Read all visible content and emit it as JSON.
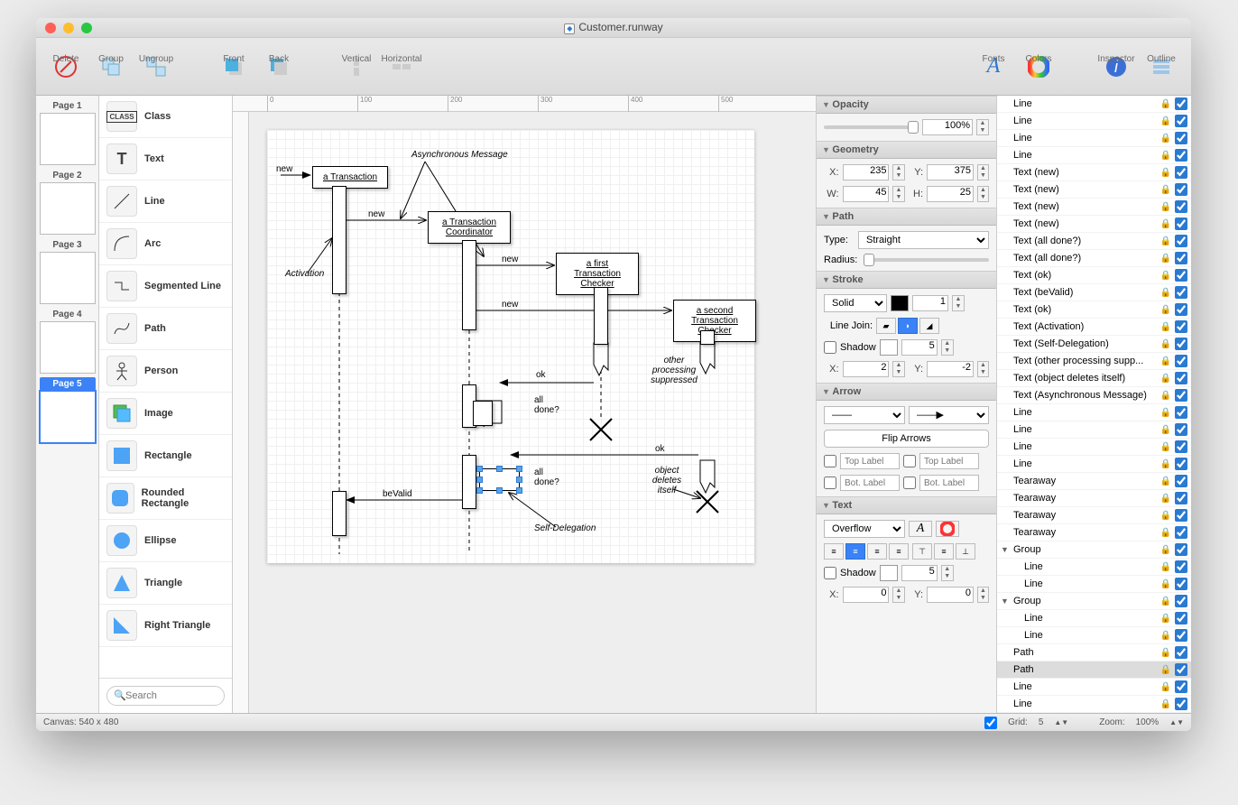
{
  "window_title": "Customer.runway",
  "toolbar": {
    "delete": "Delete",
    "group": "Group",
    "ungroup": "Ungroup",
    "front": "Front",
    "back": "Back",
    "vertical": "Vertical",
    "horizontal": "Horizontal",
    "fonts": "Fonts",
    "colors": "Colors",
    "inspector": "Inspector",
    "outline": "Outline"
  },
  "pages": [
    {
      "name": "Page 1"
    },
    {
      "name": "Page 2"
    },
    {
      "name": "Page 3"
    },
    {
      "name": "Page 4"
    },
    {
      "name": "Page 5"
    }
  ],
  "selected_page_index": 4,
  "shapes": [
    {
      "label": "Class",
      "icon": "CLASS"
    },
    {
      "label": "Text",
      "icon": "T"
    },
    {
      "label": "Line",
      "icon": "line"
    },
    {
      "label": "Arc",
      "icon": "arc"
    },
    {
      "label": "Segmented Line",
      "icon": "seg"
    },
    {
      "label": "Path",
      "icon": "path"
    },
    {
      "label": "Person",
      "icon": "person"
    },
    {
      "label": "Image",
      "icon": "image"
    },
    {
      "label": "Rectangle",
      "icon": "rect"
    },
    {
      "label": "Rounded Rectangle",
      "icon": "rrect"
    },
    {
      "label": "Ellipse",
      "icon": "ellipse"
    },
    {
      "label": "Triangle",
      "icon": "tri"
    },
    {
      "label": "Right Triangle",
      "icon": "rtri"
    }
  ],
  "search_placeholder": "Search",
  "ruler_ticks": [
    "0",
    "100",
    "200",
    "300",
    "400",
    "500"
  ],
  "diagram": {
    "boxes": {
      "transaction": "a Transaction",
      "coordinator": "a Transaction Coordinator",
      "first_checker": "a first Transaction Checker",
      "second_checker": "a second Transaction Checker"
    },
    "labels": {
      "new1": "new",
      "new2": "new",
      "new3": "new",
      "new4": "new",
      "asynchronous": "Asynchronous Message",
      "activation": "Activation",
      "ok1": "ok",
      "ok2": "ok",
      "alldone1": "all done?",
      "alldone2": "all done?",
      "other": "other processing suppressed",
      "bevalid": "beValid",
      "objdel": "object deletes itself",
      "selfdel": "Self-Delegation"
    }
  },
  "inspector": {
    "opacity_label": "Opacity",
    "opacity_value": "100%",
    "geometry_label": "Geometry",
    "x_label": "X:",
    "x": "235",
    "y_label": "Y:",
    "y": "375",
    "w_label": "W:",
    "w": "45",
    "h_label": "H:",
    "h": "25",
    "path_label": "Path",
    "type_label": "Type:",
    "type_value": "Straight",
    "radius_label": "Radius:",
    "stroke_label": "Stroke",
    "stroke_style": "Solid",
    "stroke_width": "1",
    "linejoin_label": "Line Join:",
    "shadow_label": "Shadow",
    "shadow_blur": "5",
    "shadow_x_label": "X:",
    "shadow_x": "2",
    "shadow_y_label": "Y:",
    "shadow_y": "-2",
    "arrow_label": "Arrow",
    "flip_label": "Flip Arrows",
    "top_label": "Top Label",
    "bot_label": "Bot. Label",
    "text_label": "Text",
    "overflow": "Overflow",
    "text_shadow_label": "Shadow",
    "text_shadow": "5",
    "tx_label": "X:",
    "tx": "0",
    "ty_label": "Y:",
    "ty": "0"
  },
  "outline": [
    {
      "label": "Line",
      "indent": 0
    },
    {
      "label": "Line",
      "indent": 0
    },
    {
      "label": "Line",
      "indent": 0
    },
    {
      "label": "Line",
      "indent": 0
    },
    {
      "label": "Text (new)",
      "indent": 0
    },
    {
      "label": "Text (new)",
      "indent": 0
    },
    {
      "label": "Text (new)",
      "indent": 0
    },
    {
      "label": "Text (new)",
      "indent": 0
    },
    {
      "label": "Text (all done?)",
      "indent": 0
    },
    {
      "label": "Text (all done?)",
      "indent": 0
    },
    {
      "label": "Text (ok)",
      "indent": 0
    },
    {
      "label": "Text (beValid)",
      "indent": 0
    },
    {
      "label": "Text (ok)",
      "indent": 0
    },
    {
      "label": "Text (Activation)",
      "indent": 0
    },
    {
      "label": "Text (Self-Delegation)",
      "indent": 0
    },
    {
      "label": "Text (other processing supp...",
      "indent": 0
    },
    {
      "label": "Text (object deletes itself)",
      "indent": 0
    },
    {
      "label": "Text (Asynchronous Message)",
      "indent": 0
    },
    {
      "label": "Line",
      "indent": 0
    },
    {
      "label": "Line",
      "indent": 0
    },
    {
      "label": "Line",
      "indent": 0
    },
    {
      "label": "Line",
      "indent": 0
    },
    {
      "label": "Tearaway",
      "indent": 0
    },
    {
      "label": "Tearaway",
      "indent": 0
    },
    {
      "label": "Tearaway",
      "indent": 0
    },
    {
      "label": "Tearaway",
      "indent": 0
    },
    {
      "label": "Group",
      "indent": 0,
      "group": true
    },
    {
      "label": "Line",
      "indent": 1
    },
    {
      "label": "Line",
      "indent": 1
    },
    {
      "label": "Group",
      "indent": 0,
      "group": true
    },
    {
      "label": "Line",
      "indent": 1
    },
    {
      "label": "Line",
      "indent": 1
    },
    {
      "label": "Path",
      "indent": 0
    },
    {
      "label": "Path",
      "indent": 0,
      "selected": true
    },
    {
      "label": "Line",
      "indent": 0
    },
    {
      "label": "Line",
      "indent": 0
    }
  ],
  "status": {
    "canvas": "Canvas: 540 x 480",
    "grid_label": "Grid:",
    "grid": "5",
    "zoom_label": "Zoom:",
    "zoom": "100%"
  }
}
